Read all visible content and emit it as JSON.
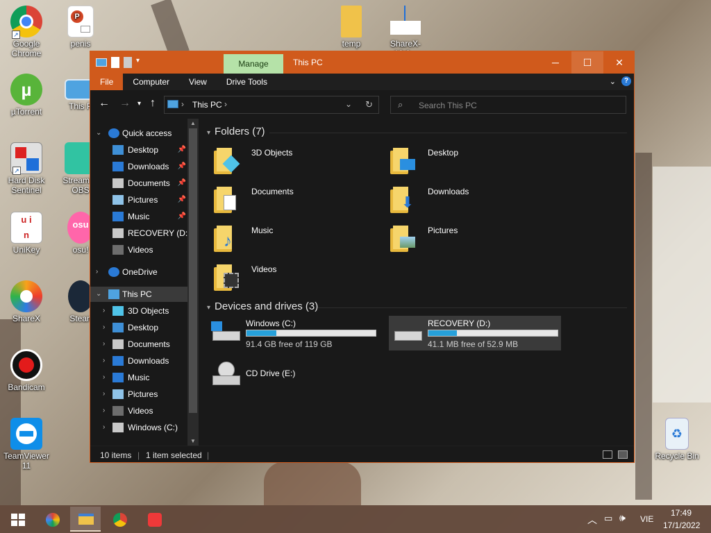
{
  "desktop": {
    "icons": [
      {
        "label": "Google Chrome",
        "icon": "chrome-icon"
      },
      {
        "label": "penis",
        "icon": "powerpoint-file-icon"
      },
      {
        "label": "temp",
        "icon": "folder-icon"
      },
      {
        "label": "ShareX-13.6...",
        "icon": "download-file-icon"
      },
      {
        "label": "µTorrent",
        "icon": "utorrent-icon"
      },
      {
        "label": "This P",
        "icon": "this-pc-icon"
      },
      {
        "label": "Hard Disk Sentinel",
        "icon": "hard-disk-sentinel-icon"
      },
      {
        "label": "Streaml... OBS",
        "icon": "streamlabs-obs-icon"
      },
      {
        "label": "UniKey",
        "icon": "unikey-icon"
      },
      {
        "label": "osu!",
        "icon": "osu-icon"
      },
      {
        "label": "ShareX",
        "icon": "sharex-icon"
      },
      {
        "label": "Stean",
        "icon": "steam-icon"
      },
      {
        "label": "Bandicam",
        "icon": "bandicam-icon"
      },
      {
        "label": "TeamViewer 11",
        "icon": "teamviewer-icon"
      },
      {
        "label": "Recycle Bin",
        "icon": "recycle-bin-icon"
      }
    ]
  },
  "window": {
    "title": "This PC",
    "contextual_tab": "Manage",
    "accent": "#d05a1c",
    "ribbon_tabs": [
      "File",
      "Computer",
      "View",
      "Drive Tools"
    ],
    "address": {
      "location": "This PC"
    },
    "search": {
      "placeholder": "Search This PC"
    },
    "nav_pane": [
      {
        "label": "Quick access",
        "icon": "star-icon",
        "level": 0,
        "pinned": false,
        "expander": "expanded"
      },
      {
        "label": "Desktop",
        "icon": "desktop-folder-icon",
        "level": 1,
        "pinned": true
      },
      {
        "label": "Downloads",
        "icon": "downloads-icon",
        "level": 1,
        "pinned": true
      },
      {
        "label": "Documents",
        "icon": "documents-icon",
        "level": 1,
        "pinned": true
      },
      {
        "label": "Pictures",
        "icon": "pictures-icon",
        "level": 1,
        "pinned": true
      },
      {
        "label": "Music",
        "icon": "music-icon",
        "level": 1,
        "pinned": true
      },
      {
        "label": "RECOVERY (D:)",
        "icon": "drive-icon",
        "level": 1,
        "pinned": false
      },
      {
        "label": "Videos",
        "icon": "videos-icon",
        "level": 1,
        "pinned": false
      },
      {
        "label": "OneDrive",
        "icon": "onedrive-icon",
        "level": 0,
        "pinned": false,
        "expander": "collapsed"
      },
      {
        "label": "This PC",
        "icon": "this-pc-icon",
        "level": 0,
        "pinned": false,
        "expander": "expanded",
        "selected": true
      },
      {
        "label": "3D Objects",
        "icon": "3d-objects-icon",
        "level": 1,
        "pinned": false,
        "expander": "collapsed"
      },
      {
        "label": "Desktop",
        "icon": "desktop-folder-icon",
        "level": 1,
        "pinned": false,
        "expander": "collapsed"
      },
      {
        "label": "Documents",
        "icon": "documents-icon",
        "level": 1,
        "pinned": false,
        "expander": "collapsed"
      },
      {
        "label": "Downloads",
        "icon": "downloads-icon",
        "level": 1,
        "pinned": false,
        "expander": "collapsed"
      },
      {
        "label": "Music",
        "icon": "music-icon",
        "level": 1,
        "pinned": false,
        "expander": "collapsed"
      },
      {
        "label": "Pictures",
        "icon": "pictures-icon",
        "level": 1,
        "pinned": false,
        "expander": "collapsed"
      },
      {
        "label": "Videos",
        "icon": "videos-icon",
        "level": 1,
        "pinned": false,
        "expander": "collapsed"
      },
      {
        "label": "Windows (C:)",
        "icon": "drive-icon",
        "level": 1,
        "pinned": false,
        "expander": "collapsed"
      }
    ],
    "folders_group": {
      "title": "Folders (7)"
    },
    "folders": [
      {
        "name": "3D Objects",
        "overlay": "3d-objects-icon"
      },
      {
        "name": "Desktop",
        "overlay": "desktop-icon"
      },
      {
        "name": "Documents",
        "overlay": "document-icon"
      },
      {
        "name": "Downloads",
        "overlay": "download-arrow-icon"
      },
      {
        "name": "Music",
        "overlay": "music-note-icon"
      },
      {
        "name": "Pictures",
        "overlay": "picture-icon"
      },
      {
        "name": "Videos",
        "overlay": "film-icon"
      }
    ],
    "drives_group": {
      "title": "Devices and drives (3)"
    },
    "drives": [
      {
        "name": "Windows (C:)",
        "free_text": "91.4 GB free of 119 GB",
        "used_fraction": 0.23,
        "selected": false,
        "icon": "windows-drive-icon"
      },
      {
        "name": "RECOVERY (D:)",
        "free_text": "41.1 MB free of 52.9 MB",
        "used_fraction": 0.22,
        "selected": true,
        "icon": "drive-icon"
      },
      {
        "name": "CD Drive (E:)",
        "free_text": "",
        "used_fraction": null,
        "selected": false,
        "icon": "cd-drive-icon"
      }
    ],
    "status": {
      "items": "10 items",
      "selected": "1 item selected"
    }
  },
  "taskbar": {
    "apps": [
      "start-icon",
      "cortana-icon",
      "file-explorer-icon",
      "chrome-icon",
      "vivaldi-icon"
    ],
    "language": "VIE",
    "time": "17:49",
    "date": "17/1/2022"
  }
}
